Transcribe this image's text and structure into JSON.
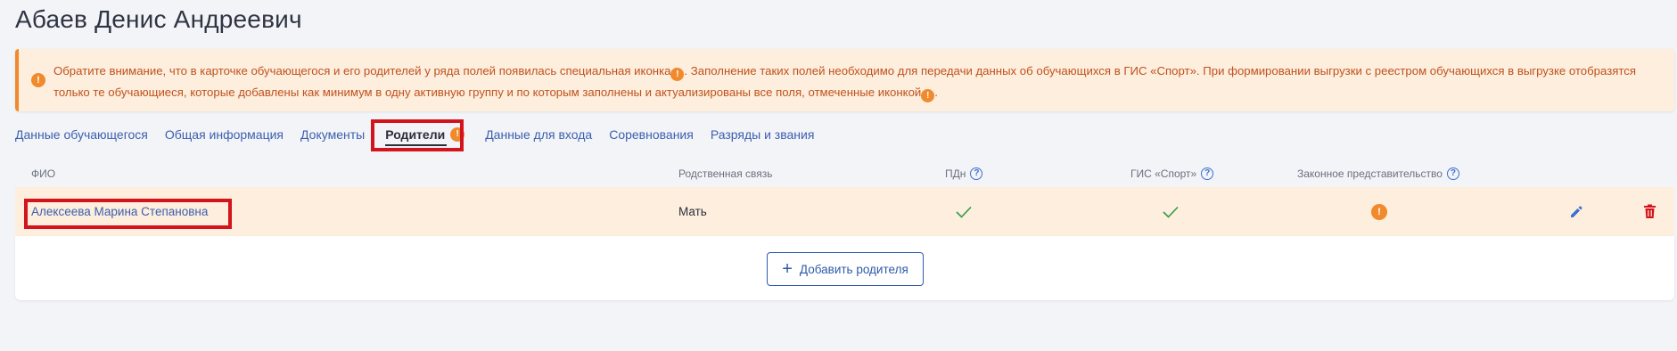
{
  "page": {
    "title": "Абаев Денис Андреевич"
  },
  "alert": {
    "text_part1": "Обратите внимание, что в карточке обучающегося и его родителей у ряда полей появилась специальная иконка",
    "text_part2": ". Заполнение таких полей необходимо для передачи данных об обучающихся в ГИС «Спорт». При формировании выгрузки с реестром обучающихся в выгрузке отобразятся только те обучающиеся, которые добавлены как минимум в одну активную группу и по которым заполнены и актуализированы все поля, отмеченные иконкой",
    "text_part3": ".",
    "icon_glyph": "!"
  },
  "tabs": [
    {
      "label": "Данные обучающегося"
    },
    {
      "label": "Общая информация"
    },
    {
      "label": "Документы"
    },
    {
      "label": "Родители",
      "active": true,
      "badge": "!"
    },
    {
      "label": "Данные для входа"
    },
    {
      "label": "Соревнования"
    },
    {
      "label": "Разряды и звания"
    }
  ],
  "table": {
    "headers": {
      "name": "ФИО",
      "relation": "Родственная связь",
      "pdn": "ПДн",
      "gis": "ГИС «Спорт»",
      "legal": "Законное представительство",
      "help_glyph": "?"
    },
    "rows": [
      {
        "name": "Алексеева Марина Степановна",
        "relation": "Мать",
        "pdn": "check",
        "gis": "check",
        "legal_glyph": "!"
      }
    ]
  },
  "add_button": {
    "label": "Добавить родителя",
    "plus": "+"
  },
  "colors": {
    "accent": "#3b5fb0",
    "warning": "#f08a2c",
    "alert_bg": "#fdeedd",
    "success": "#2e9e44",
    "danger": "#d4141c"
  }
}
